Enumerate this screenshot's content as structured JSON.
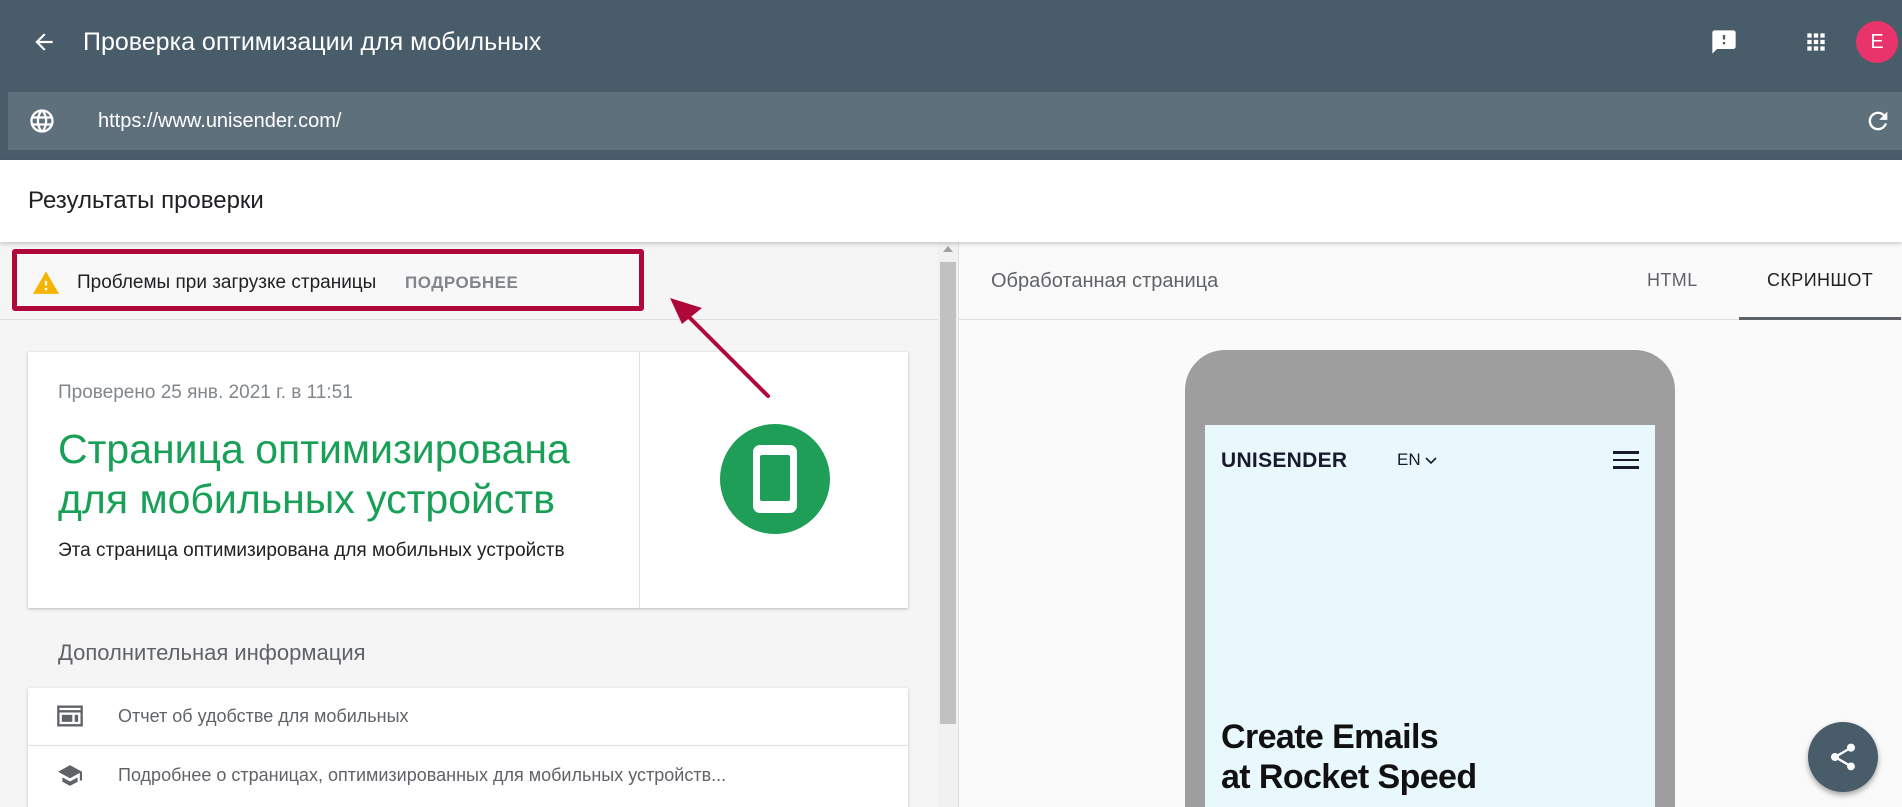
{
  "header": {
    "title": "Проверка оптимизации для мобильных",
    "avatar_letter": "E"
  },
  "urlbar": {
    "value": "https://www.unisender.com/"
  },
  "results": {
    "title": "Результаты проверки"
  },
  "alert": {
    "text": "Проблемы при загрузке страницы",
    "link_label": "ПОДРОБНЕЕ"
  },
  "card": {
    "checked_date": "Проверено 25 янв. 2021 г. в 11:51",
    "verdict": "Страница оптимизирована для мобильных устройств",
    "subtitle": "Эта страница оптимизирована для мобильных устройств"
  },
  "more_info": {
    "title": "Дополнительная информация",
    "items": [
      {
        "label": "Отчет об удобстве для мобильных",
        "icon": "web-report-icon"
      },
      {
        "label": "Подробнее о страницах, оптимизированных для мобильных устройств...",
        "icon": "school-cap-icon"
      }
    ]
  },
  "right_panel": {
    "label": "Обработанная страница",
    "tabs": [
      {
        "label": "HTML",
        "selected": false
      },
      {
        "label": "СКРИНШОТ",
        "selected": true
      }
    ]
  },
  "screenshot": {
    "site_logo": "UNISENDER",
    "site_lang": "EN",
    "headline_line1": "Create Emails",
    "headline_line2": "at Rocket Speed"
  },
  "colors": {
    "appbar": "#485c69",
    "urlbar": "#5d707c",
    "success": "#18a057",
    "alert_border": "#b0073a",
    "avatar": "#e8336b",
    "warning": "#f4b400"
  }
}
